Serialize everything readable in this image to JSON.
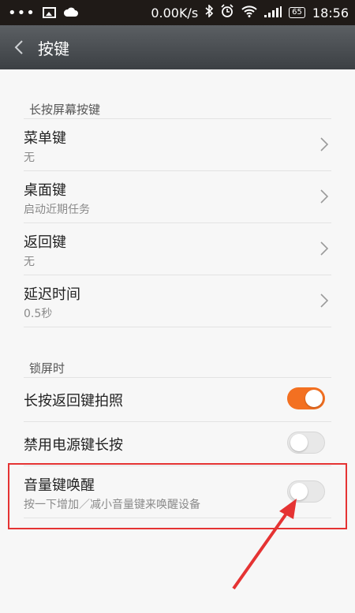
{
  "statusbar": {
    "dots": "•••",
    "speed": "0.00K/s",
    "battery": "65",
    "time": "18:56"
  },
  "header": {
    "title": "按键"
  },
  "sections": [
    {
      "header": "长按屏幕按键",
      "rows": [
        {
          "title": "菜单键",
          "subtitle": "无"
        },
        {
          "title": "桌面键",
          "subtitle": "启动近期任务"
        },
        {
          "title": "返回键",
          "subtitle": "无"
        },
        {
          "title": "延迟时间",
          "subtitle": "0.5秒"
        }
      ]
    },
    {
      "header": "锁屏时",
      "toggles": [
        {
          "title": "长按返回键拍照",
          "on": true
        },
        {
          "title": "禁用电源键长按",
          "on": false
        },
        {
          "title": "音量键唤醒",
          "subtitle": "按一下增加／减小音量键来唤醒设备",
          "on": false
        }
      ]
    }
  ],
  "colors": {
    "accent": "#f37021",
    "annotation": "#e53333"
  }
}
